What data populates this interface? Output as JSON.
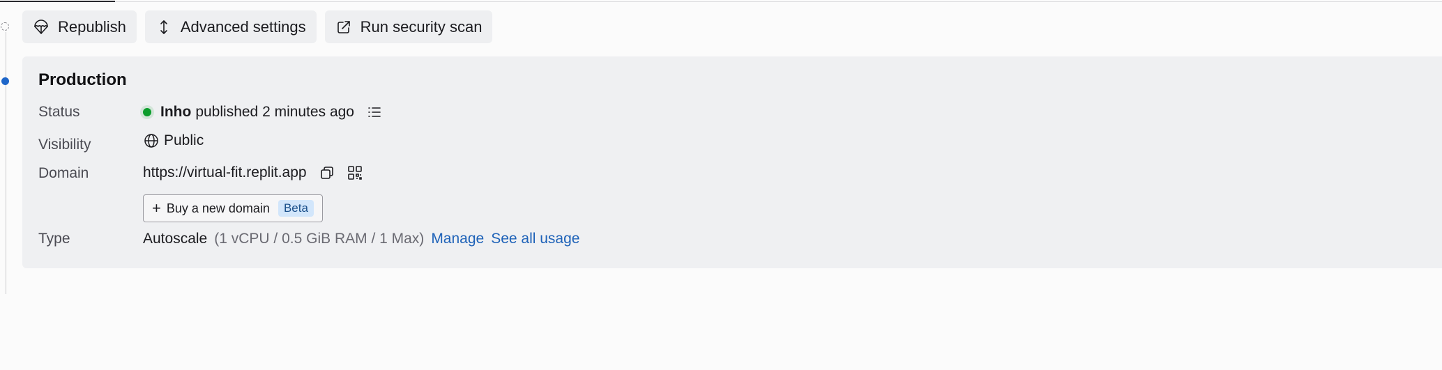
{
  "actions": {
    "republish_label": "Republish",
    "advanced_label": "Advanced settings",
    "security_scan_label": "Run security scan"
  },
  "deployment": {
    "title": "Production",
    "status": {
      "label": "Status",
      "user": "Inho",
      "text": "published 2 minutes ago",
      "dot_color": "#0c9d2c"
    },
    "visibility": {
      "label": "Visibility",
      "value": "Public"
    },
    "domain": {
      "label": "Domain",
      "url": "https://virtual-fit.replit.app",
      "buy_label": "Buy a new domain",
      "beta_badge": "Beta"
    },
    "type": {
      "label": "Type",
      "value": "Autoscale",
      "spec": "(1 vCPU / 0.5 GiB RAM / 1 Max)",
      "manage_link": "Manage",
      "usage_link": "See all usage"
    }
  },
  "colors": {
    "accent": "#1e66c9",
    "link": "#1e62b8",
    "card_bg": "#eff0f2"
  },
  "icons": {
    "republish": "parachute-icon",
    "advanced": "vertical-arrows-icon",
    "security": "arrow-out-box-icon",
    "logs": "list-icon",
    "visibility": "globe-icon",
    "copy": "copy-icon",
    "qr": "qr-code-icon"
  }
}
